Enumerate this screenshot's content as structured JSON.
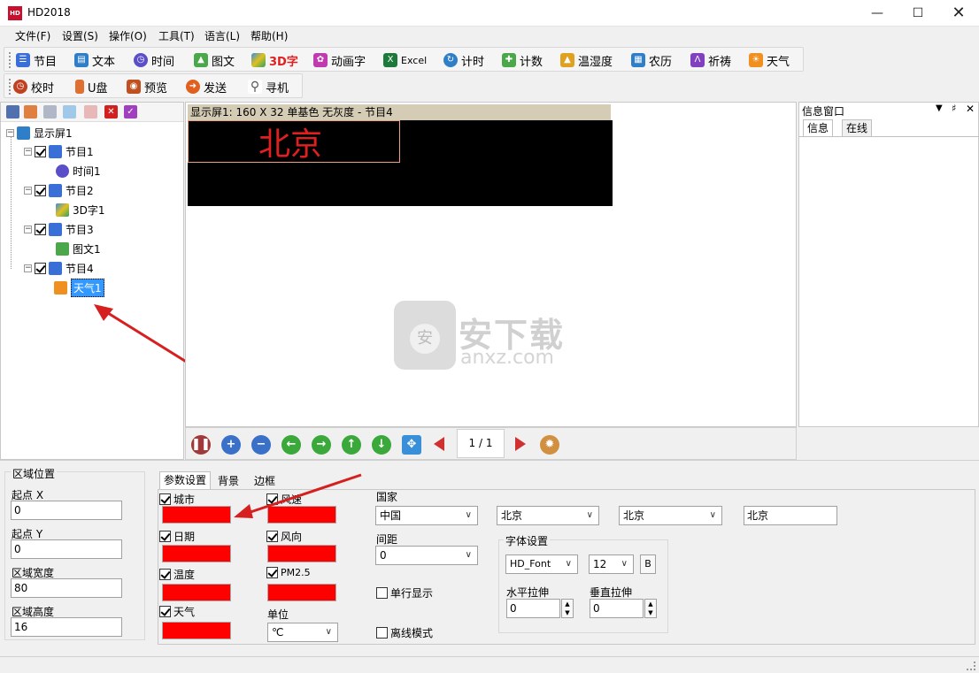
{
  "window": {
    "title": "HD2018",
    "app_icon": "HD"
  },
  "menu": [
    "文件(F)",
    "设置(S)",
    "操作(O)",
    "工具(T)",
    "语言(L)",
    "帮助(H)"
  ],
  "toolbar1": [
    {
      "label": "节目",
      "icon": "program-icon",
      "color": "#3a6fd8"
    },
    {
      "label": "文本",
      "icon": "book-icon",
      "color": "#2f7fc8"
    },
    {
      "label": "时间",
      "icon": "clock-icon",
      "color": "#5a4fc8"
    },
    {
      "label": "图文",
      "icon": "image-icon",
      "color": "#4aa84a"
    },
    {
      "label": "3D字",
      "icon": "cube-icon",
      "color": "#e02020"
    },
    {
      "label": "动画字",
      "icon": "animation-icon",
      "color": "#c03ab0"
    },
    {
      "label": "Excel",
      "icon": "excel-icon",
      "color": "#1d7a3a"
    },
    {
      "label": "计时",
      "icon": "timer-icon",
      "color": "#2f7fc8"
    },
    {
      "label": "计数",
      "icon": "counter-icon",
      "color": "#4aa84a"
    },
    {
      "label": "温湿度",
      "icon": "thermometer-icon",
      "color": "#e0a020"
    },
    {
      "label": "农历",
      "icon": "calendar-icon",
      "color": "#2f7fc8"
    },
    {
      "label": "祈祷",
      "icon": "prayer-icon",
      "color": "#8040c0"
    },
    {
      "label": "天气",
      "icon": "weather-icon",
      "color": "#f09020"
    }
  ],
  "toolbar2": [
    {
      "label": "校时",
      "icon": "clock-sync-icon",
      "color": "#c04020"
    },
    {
      "label": "U盘",
      "icon": "usb-icon",
      "color": "#e07030"
    },
    {
      "label": "预览",
      "icon": "camera-icon",
      "color": "#c05020"
    },
    {
      "label": "发送",
      "icon": "send-icon",
      "color": "#e06020"
    },
    {
      "label": "寻机",
      "icon": "search-icon",
      "color": "#808080"
    }
  ],
  "tree": {
    "root": "显示屏1",
    "items": [
      {
        "label": "节目1",
        "child": "时间1"
      },
      {
        "label": "节目2",
        "child": "3D字1"
      },
      {
        "label": "节目3",
        "child": "图文1"
      },
      {
        "label": "节目4",
        "child": "天气1"
      }
    ]
  },
  "canvas": {
    "caption": "显示屏1: 160 X 32  单基色 无灰度 - 节目4",
    "led_text": "北京",
    "page_indicator": "1 / 1"
  },
  "info_panel": {
    "title": "信息窗口",
    "tabs": [
      "信息",
      "在线"
    ]
  },
  "region": {
    "group_title": "区域位置",
    "x_label": "起点 X",
    "x_value": "0",
    "y_label": "起点 Y",
    "y_value": "0",
    "w_label": "区域宽度",
    "w_value": "80",
    "h_label": "区域高度",
    "h_value": "16"
  },
  "tabs": [
    "参数设置",
    "背景",
    "边框"
  ],
  "params": {
    "city": "城市",
    "date": "日期",
    "temp": "温度",
    "weather": "天气",
    "wind_speed": "风速",
    "wind_dir": "风向",
    "pm25": "PM2.5",
    "unit_label": "单位",
    "unit_value": "℃",
    "country_label": "国家",
    "country": "中国",
    "province": "北京",
    "city_sel": "北京",
    "city_text": "北京",
    "spacing_label": "间距",
    "spacing": "0",
    "single_line": "单行显示",
    "offline": "离线模式",
    "font_group": "字体设置",
    "font": "HD_Font",
    "font_size": "12",
    "bold": "B",
    "h_stretch_label": "水平拉伸",
    "h_stretch": "0",
    "v_stretch_label": "垂直拉伸",
    "v_stretch": "0"
  },
  "watermark": {
    "cn": "安下载",
    "en": "anxz.com"
  }
}
